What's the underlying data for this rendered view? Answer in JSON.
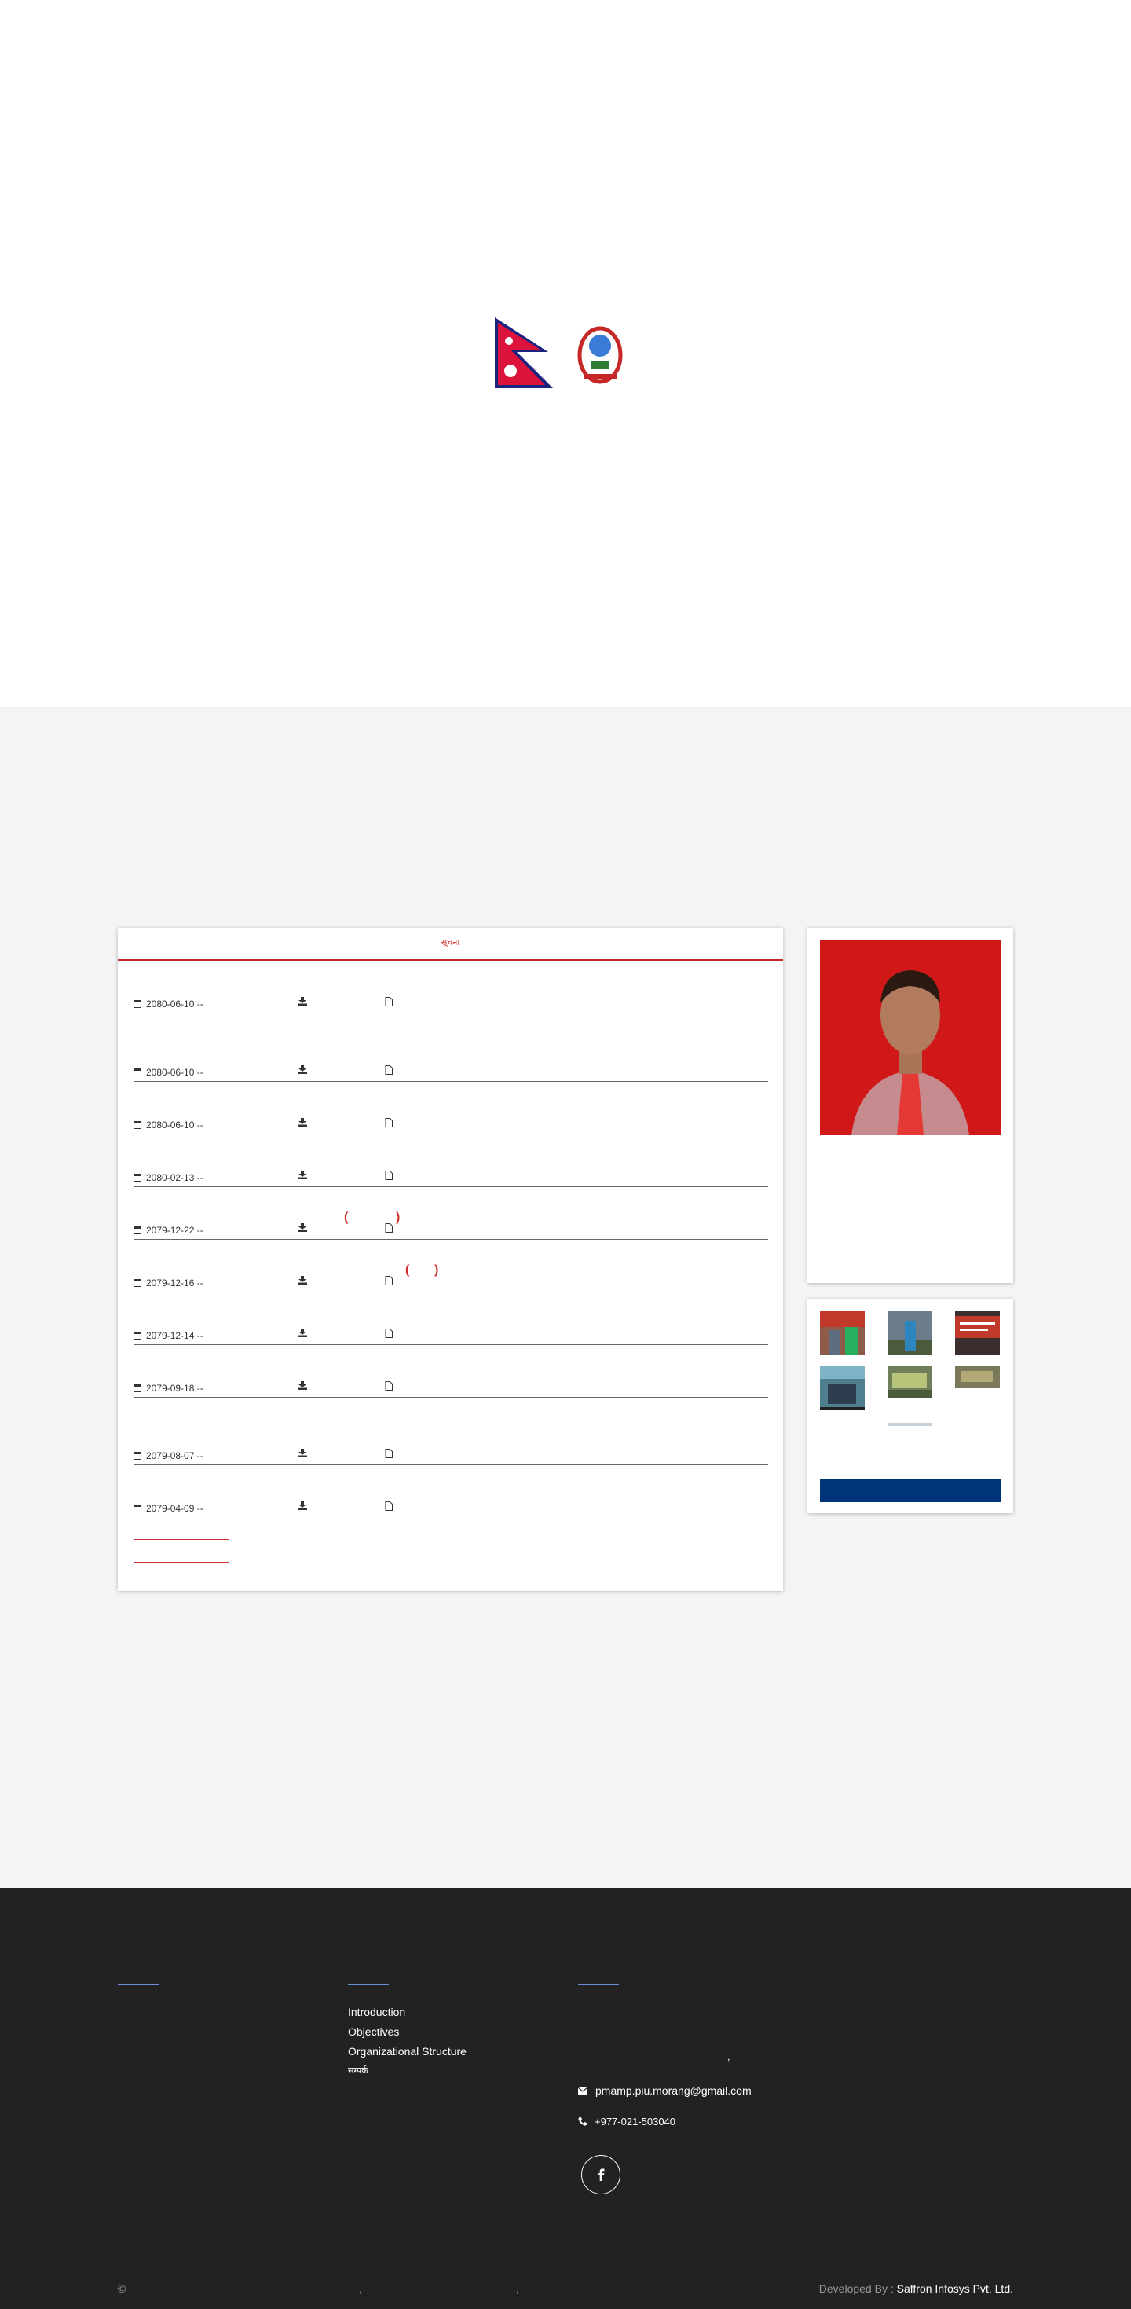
{
  "logos": {
    "flag_icon": "nepal-flag-icon",
    "emblem_icon": "nepal-emblem-icon"
  },
  "notices": {
    "title": "सूचना",
    "rows": [
      {
        "date": "2080-06-10 --"
      },
      {
        "date": "2080-06-10 --"
      },
      {
        "date": "2080-06-10 --"
      },
      {
        "date": "2080-02-13 --"
      },
      {
        "date": "2079-12-22 --"
      },
      {
        "date": "2079-12-16 --"
      },
      {
        "date": "2079-12-14 --"
      },
      {
        "date": "2079-09-18 --"
      },
      {
        "date": "2079-08-07 --"
      },
      {
        "date": "2079-04-09 --"
      }
    ],
    "paren_open": "(",
    "paren_close": ")"
  },
  "footer": {
    "links": [
      "Introduction",
      "Objectives",
      "Organizational Structure",
      "सम्पर्क"
    ],
    "comma": ",",
    "email": "pmamp.piu.morang@gmail.com",
    "phone": "+977-021-503040",
    "copyright_symbol": "©",
    "copy_comma1": ",",
    "copy_comma2": ",",
    "developed_by_label": "Developed By :",
    "developer": "Saffron Infosys Pvt. Ltd."
  },
  "colors": {
    "accent": "#d32f2f",
    "footer_bg": "#222222",
    "main_bg": "#f4f4f4",
    "blue_bar": "#003478"
  }
}
